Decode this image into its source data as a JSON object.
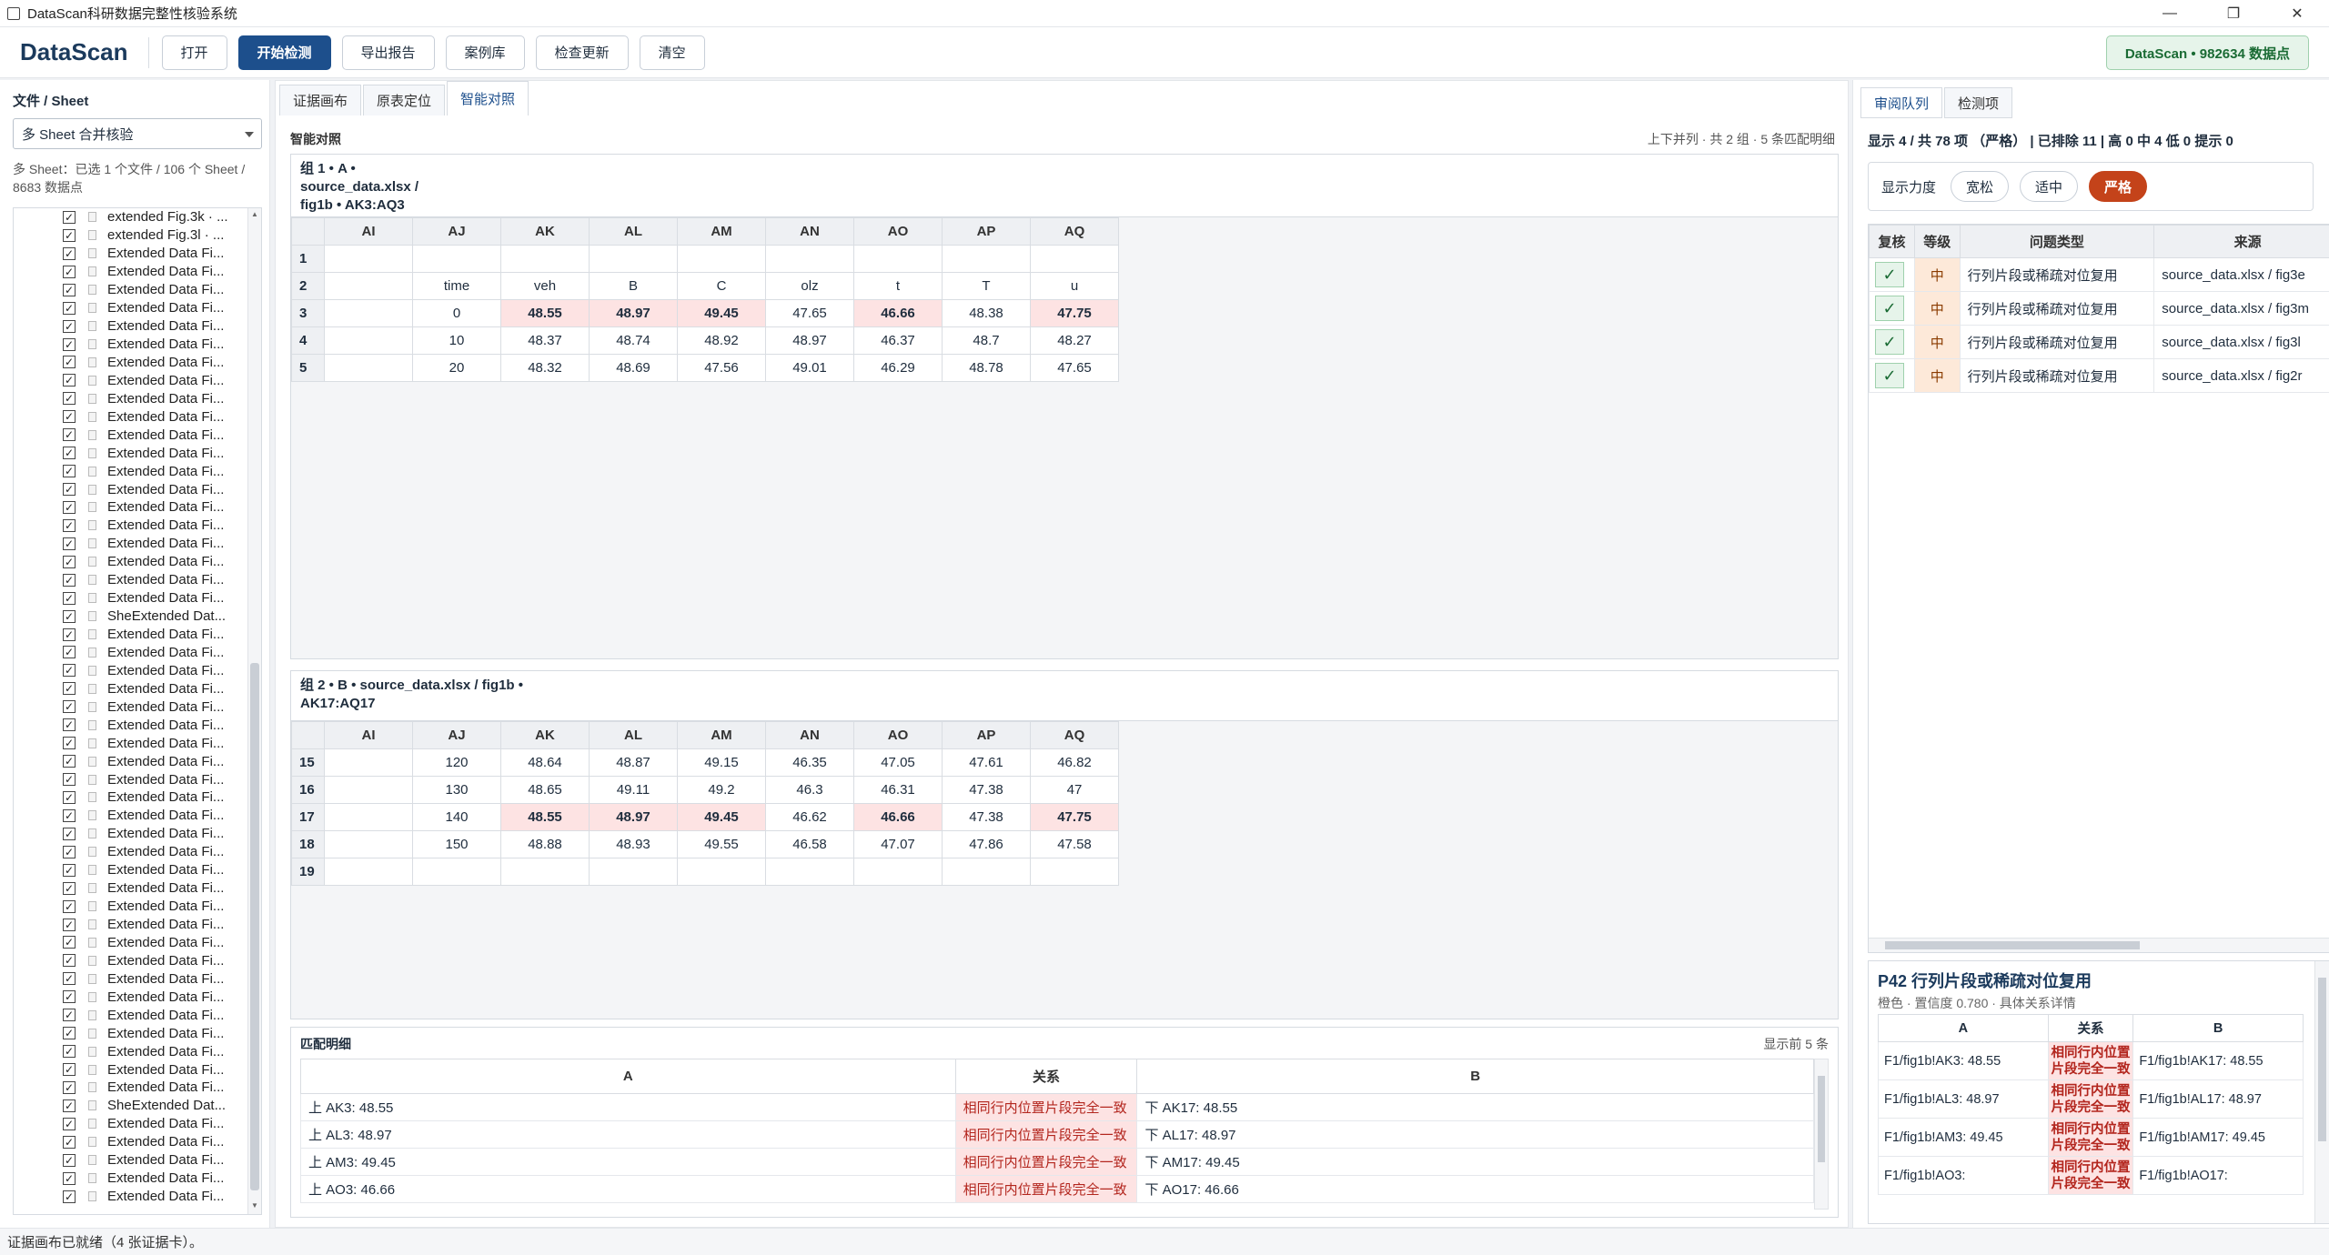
{
  "window": {
    "title": "DataScan科研数据完整性核验系统",
    "min": "—",
    "max": "❐",
    "close": "✕"
  },
  "toolbar": {
    "brand": "DataScan",
    "buttons": [
      "打开",
      "开始检测",
      "导出报告",
      "案例库",
      "检查更新",
      "清空"
    ],
    "stat": "DataScan • 982634 数据点"
  },
  "left": {
    "title": "文件 / Sheet",
    "select_value": "多 Sheet 合并核验",
    "info": "多 Sheet：已选 1 个文件 / 106 个 Sheet / 8683 数据点",
    "items": [
      "extended Fig.3k · ...",
      "extended Fig.3l · ...",
      "Extended Data Fi...",
      "Extended Data Fi...",
      "Extended Data Fi...",
      "Extended Data Fi...",
      "Extended Data Fi...",
      "Extended Data Fi...",
      "Extended Data Fi...",
      "Extended Data Fi...",
      "Extended Data Fi...",
      "Extended Data Fi...",
      "Extended Data Fi...",
      "Extended Data Fi...",
      "Extended Data Fi...",
      "Extended Data Fi...",
      "Extended Data Fi...",
      "Extended Data Fi...",
      "Extended Data Fi...",
      "Extended Data Fi...",
      "Extended Data Fi...",
      "Extended Data Fi...",
      "SheExtended Dat...",
      "Extended Data Fi...",
      "Extended Data Fi...",
      "Extended Data Fi...",
      "Extended Data Fi...",
      "Extended Data Fi...",
      "Extended Data Fi...",
      "Extended Data Fi...",
      "Extended Data Fi...",
      "Extended Data Fi...",
      "Extended Data Fi...",
      "Extended Data Fi...",
      "Extended Data Fi...",
      "Extended Data Fi...",
      "Extended Data Fi...",
      "Extended Data Fi...",
      "Extended Data Fi...",
      "Extended Data Fi...",
      "Extended Data Fi...",
      "Extended Data Fi...",
      "Extended Data Fi...",
      "Extended Data Fi...",
      "Extended Data Fi...",
      "Extended Data Fi...",
      "Extended Data Fi...",
      "Extended Data Fi...",
      "Extended Data Fi...",
      "SheExtended Dat...",
      "Extended Data Fi...",
      "Extended Data Fi...",
      "Extended Data Fi...",
      "Extended Data Fi...",
      "Extended Data Fi..."
    ]
  },
  "center": {
    "tabs": [
      "证据画布",
      "原表定位",
      "智能对照"
    ],
    "section": "智能对照",
    "section_note": "上下并列 · 共 2 组 · 5 条匹配明细",
    "columns": [
      "AI",
      "AJ",
      "AK",
      "AL",
      "AM",
      "AN",
      "AO",
      "AP",
      "AQ"
    ],
    "group1": {
      "title": "组 1 • A •\nsource_data.xlsx /\nfig1b • AK3:AQ3",
      "rows": [
        {
          "n": "1",
          "cells": [
            "",
            "",
            "",
            "",
            "",
            "",
            "",
            "",
            ""
          ]
        },
        {
          "n": "2",
          "cells": [
            "",
            "time",
            "veh",
            "B",
            "C",
            "olz",
            "t",
            "T",
            "u"
          ]
        },
        {
          "n": "3",
          "cells": [
            "",
            "0",
            "48.55",
            "48.97",
            "49.45",
            "47.65",
            "46.66",
            "48.38",
            "47.75"
          ],
          "hl": [
            2,
            3,
            4,
            6,
            8
          ]
        },
        {
          "n": "4",
          "cells": [
            "",
            "10",
            "48.37",
            "48.74",
            "48.92",
            "48.97",
            "46.37",
            "48.7",
            "48.27"
          ]
        },
        {
          "n": "5",
          "cells": [
            "",
            "20",
            "48.32",
            "48.69",
            "47.56",
            "49.01",
            "46.29",
            "48.78",
            "47.65"
          ]
        }
      ]
    },
    "group2": {
      "title": "组 2 • B • source_data.xlsx / fig1b •\nAK17:AQ17",
      "rows": [
        {
          "n": "15",
          "cells": [
            "",
            "120",
            "48.64",
            "48.87",
            "49.15",
            "46.35",
            "47.05",
            "47.61",
            "46.82"
          ]
        },
        {
          "n": "16",
          "cells": [
            "",
            "130",
            "48.65",
            "49.11",
            "49.2",
            "46.3",
            "46.31",
            "47.38",
            "47"
          ]
        },
        {
          "n": "17",
          "cells": [
            "",
            "140",
            "48.55",
            "48.97",
            "49.45",
            "46.62",
            "46.66",
            "47.38",
            "47.75"
          ],
          "hl": [
            2,
            3,
            4,
            6,
            8
          ]
        },
        {
          "n": "18",
          "cells": [
            "",
            "150",
            "48.88",
            "48.93",
            "49.55",
            "46.58",
            "47.07",
            "47.86",
            "47.58"
          ]
        },
        {
          "n": "19",
          "cells": [
            "",
            "",
            "",
            "",
            "",
            "",
            "",
            "",
            ""
          ]
        }
      ]
    },
    "match": {
      "title": "匹配明细",
      "count": "显示前 5 条",
      "headers": [
        "A",
        "关系",
        "B"
      ],
      "rows": [
        [
          "上 AK3: 48.55",
          "相同行内位置片段完全一致",
          "下 AK17: 48.55"
        ],
        [
          "上 AL3: 48.97",
          "相同行内位置片段完全一致",
          "下 AL17: 48.97"
        ],
        [
          "上 AM3: 49.45",
          "相同行内位置片段完全一致",
          "下 AM17: 49.45"
        ],
        [
          "上 AO3: 46.66",
          "相同行内位置片段完全一致",
          "下 AO17: 46.66"
        ]
      ]
    }
  },
  "right": {
    "tabs": [
      "审阅队列",
      "检测项"
    ],
    "summary": "显示 4 / 共 78 项 （严格） | 已排除 11 | 高 0 中 4 低 0 提示 0",
    "strict_label": "显示力度",
    "strict_options": [
      "宽松",
      "适中",
      "严格"
    ],
    "queue_headers": [
      "复核",
      "等级",
      "问题类型",
      "来源"
    ],
    "queue": [
      {
        "check": "✓",
        "level": "中",
        "type": "行列片段或稀疏对位复用",
        "src": "source_data.xlsx / fig3e"
      },
      {
        "check": "✓",
        "level": "中",
        "type": "行列片段或稀疏对位复用",
        "src": "source_data.xlsx / fig3m"
      },
      {
        "check": "✓",
        "level": "中",
        "type": "行列片段或稀疏对位复用",
        "src": "source_data.xlsx / fig3l"
      },
      {
        "check": "✓",
        "level": "中",
        "type": "行列片段或稀疏对位复用",
        "src": "source_data.xlsx / fig2r"
      }
    ],
    "detail": {
      "title": "P42 行列片段或稀疏对位复用",
      "subtitle": "橙色 · 置信度 0.780 · 具体关系详情",
      "headers": [
        "A",
        "关系",
        "B"
      ],
      "rows": [
        [
          "F1/fig1b!AK3: 48.55",
          "相同行内位置片段完全一致",
          "F1/fig1b!AK17: 48.55"
        ],
        [
          "F1/fig1b!AL3: 48.97",
          "相同行内位置片段完全一致",
          "F1/fig1b!AL17: 48.97"
        ],
        [
          "F1/fig1b!AM3: 49.45",
          "相同行内位置片段完全一致",
          "F1/fig1b!AM17: 49.45"
        ],
        [
          "F1/fig1b!AO3:",
          "相同行内位置片段完全一致",
          "F1/fig1b!AO17:"
        ]
      ]
    }
  },
  "status": "证据画布已就绪（4 张证据卡）。"
}
